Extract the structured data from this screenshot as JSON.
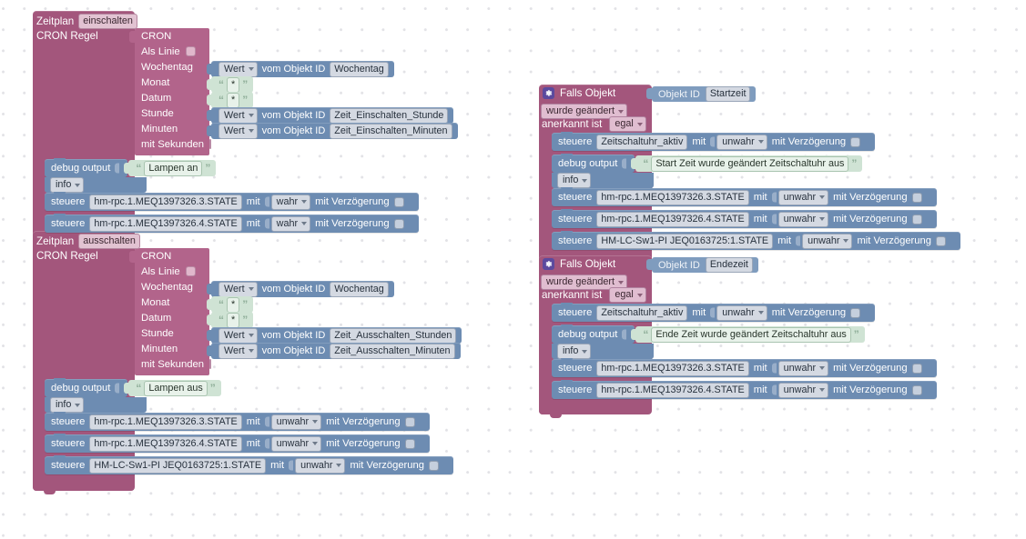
{
  "app": {
    "surface": "blockly-workspace",
    "colors": {
      "event_block": "#a3567c",
      "cron_panel": "#b2648b",
      "action_block": "#6d8cb2",
      "string_block": "#cfe3d4",
      "gear_badge": "#5b4a9e",
      "canvas": "#ffffff",
      "grid_dot": "#e2e2e6"
    }
  },
  "labels": {
    "zeitplan": "Zeitplan",
    "cron_regel": "CRON Regel",
    "cron": "CRON",
    "als_linie": "Als Linie",
    "wochentag": "Wochentag",
    "monat": "Monat",
    "datum": "Datum",
    "stunde": "Stunde",
    "minuten": "Minuten",
    "mit_sekunden": "mit Sekunden",
    "debug_output": "debug output",
    "info": "info",
    "steuere": "steuere",
    "mit": "mit",
    "mit_verzoegerung": "mit Verzögerung",
    "wert": "Wert",
    "vom_objekt_id": "vom Objekt ID",
    "falls_objekt": "Falls Objekt",
    "objekt_id": "Objekt ID",
    "wurde_geaendert": "wurde geändert",
    "anerkannt_ist": "anerkannt ist",
    "egal": "egal",
    "wahr": "wahr",
    "unwahr": "unwahr",
    "wildcard": "*"
  },
  "groups": [
    {
      "id": "zeitplan-einschalten",
      "title": "Zeitplan",
      "mode": "einschalten",
      "subtitle": "CRON Regel",
      "cron": {
        "header": "CRON",
        "als_linie": {
          "label": "Als Linie",
          "checked": false
        },
        "mit_sekunden": {
          "label": "mit Sekunden",
          "checked": false
        },
        "fields": [
          {
            "label": "Wochentag",
            "kind": "value",
            "select": "Wert",
            "connector": "vom Objekt ID",
            "object_id": "Wochentag"
          },
          {
            "label": "Monat",
            "kind": "string",
            "value": "*"
          },
          {
            "label": "Datum",
            "kind": "string",
            "value": "*"
          },
          {
            "label": "Stunde",
            "kind": "value",
            "select": "Wert",
            "connector": "vom Objekt ID",
            "object_id": "Zeit_Einschalten_Stunde"
          },
          {
            "label": "Minuten",
            "kind": "value",
            "select": "Wert",
            "connector": "vom Objekt ID",
            "object_id": "Zeit_Einschalten_Minuten"
          }
        ]
      },
      "statements": [
        {
          "type": "debug",
          "label": "debug output",
          "text": "Lampen an",
          "level": "info"
        },
        {
          "type": "control",
          "label": "steuere",
          "target": "hm-rpc.1.MEQ1397326.3.STATE",
          "with_label": "mit",
          "value": "wahr",
          "delay_label": "mit Verzögerung",
          "delay": false
        },
        {
          "type": "control",
          "label": "steuere",
          "target": "hm-rpc.1.MEQ1397326.4.STATE",
          "with_label": "mit",
          "value": "wahr",
          "delay_label": "mit Verzögerung",
          "delay": false
        }
      ]
    },
    {
      "id": "zeitplan-ausschalten",
      "title": "Zeitplan",
      "mode": "ausschalten",
      "subtitle": "CRON Regel",
      "cron": {
        "header": "CRON",
        "als_linie": {
          "label": "Als Linie",
          "checked": false
        },
        "mit_sekunden": {
          "label": "mit Sekunden",
          "checked": false
        },
        "fields": [
          {
            "label": "Wochentag",
            "kind": "value",
            "select": "Wert",
            "connector": "vom Objekt ID",
            "object_id": "Wochentag"
          },
          {
            "label": "Monat",
            "kind": "string",
            "value": "*"
          },
          {
            "label": "Datum",
            "kind": "string",
            "value": "*"
          },
          {
            "label": "Stunde",
            "kind": "value",
            "select": "Wert",
            "connector": "vom Objekt ID",
            "object_id": "Zeit_Ausschalten_Stunden"
          },
          {
            "label": "Minuten",
            "kind": "value",
            "select": "Wert",
            "connector": "vom Objekt ID",
            "object_id": "Zeit_Ausschalten_Minuten"
          }
        ]
      },
      "statements": [
        {
          "type": "debug",
          "label": "debug output",
          "text": "Lampen aus",
          "level": "info"
        },
        {
          "type": "control",
          "label": "steuere",
          "target": "hm-rpc.1.MEQ1397326.3.STATE",
          "with_label": "mit",
          "value": "unwahr",
          "delay_label": "mit Verzögerung",
          "delay": false
        },
        {
          "type": "control",
          "label": "steuere",
          "target": "hm-rpc.1.MEQ1397326.4.STATE",
          "with_label": "mit",
          "value": "unwahr",
          "delay_label": "mit Verzögerung",
          "delay": false
        },
        {
          "type": "control",
          "label": "steuere",
          "target": "HM-LC-Sw1-PI JEQ0163725:1.STATE",
          "with_label": "mit",
          "value": "unwahr",
          "delay_label": "mit Verzögerung",
          "delay": false
        }
      ]
    }
  ],
  "triggers": [
    {
      "id": "falls-objekt-startzeit",
      "title": "Falls Objekt",
      "objekt_id_label": "Objekt ID",
      "objekt_id": "Startzeit",
      "change_mode": "wurde geändert",
      "ack_label": "anerkannt ist",
      "ack_value": "egal",
      "statements": [
        {
          "type": "control",
          "label": "steuere",
          "target": "Zeitschaltuhr_aktiv",
          "with_label": "mit",
          "value": "unwahr",
          "delay_label": "mit Verzögerung",
          "delay": false
        },
        {
          "type": "debug",
          "label": "debug output",
          "text": "Start Zeit wurde geändert Zeitschaltuhr aus",
          "level": "info"
        },
        {
          "type": "control",
          "label": "steuere",
          "target": "hm-rpc.1.MEQ1397326.3.STATE",
          "with_label": "mit",
          "value": "unwahr",
          "delay_label": "mit Verzögerung",
          "delay": false
        },
        {
          "type": "control",
          "label": "steuere",
          "target": "hm-rpc.1.MEQ1397326.4.STATE",
          "with_label": "mit",
          "value": "unwahr",
          "delay_label": "mit Verzögerung",
          "delay": false
        },
        {
          "type": "control",
          "label": "steuere",
          "target": "HM-LC-Sw1-PI JEQ0163725:1.STATE",
          "with_label": "mit",
          "value": "unwahr",
          "delay_label": "mit Verzögerung",
          "delay": false
        }
      ]
    },
    {
      "id": "falls-objekt-endezeit",
      "title": "Falls Objekt",
      "objekt_id_label": "Objekt ID",
      "objekt_id": "Endezeit",
      "change_mode": "wurde geändert",
      "ack_label": "anerkannt ist",
      "ack_value": "egal",
      "statements": [
        {
          "type": "control",
          "label": "steuere",
          "target": "Zeitschaltuhr_aktiv",
          "with_label": "mit",
          "value": "unwahr",
          "delay_label": "mit Verzögerung",
          "delay": false
        },
        {
          "type": "debug",
          "label": "debug output",
          "text": "Ende Zeit wurde geändert Zeitschaltuhr aus",
          "level": "info"
        },
        {
          "type": "control",
          "label": "steuere",
          "target": "hm-rpc.1.MEQ1397326.3.STATE",
          "with_label": "mit",
          "value": "unwahr",
          "delay_label": "mit Verzögerung",
          "delay": false
        },
        {
          "type": "control",
          "label": "steuere",
          "target": "hm-rpc.1.MEQ1397326.4.STATE",
          "with_label": "mit",
          "value": "unwahr",
          "delay_label": "mit Verzögerung",
          "delay": false
        }
      ]
    }
  ]
}
